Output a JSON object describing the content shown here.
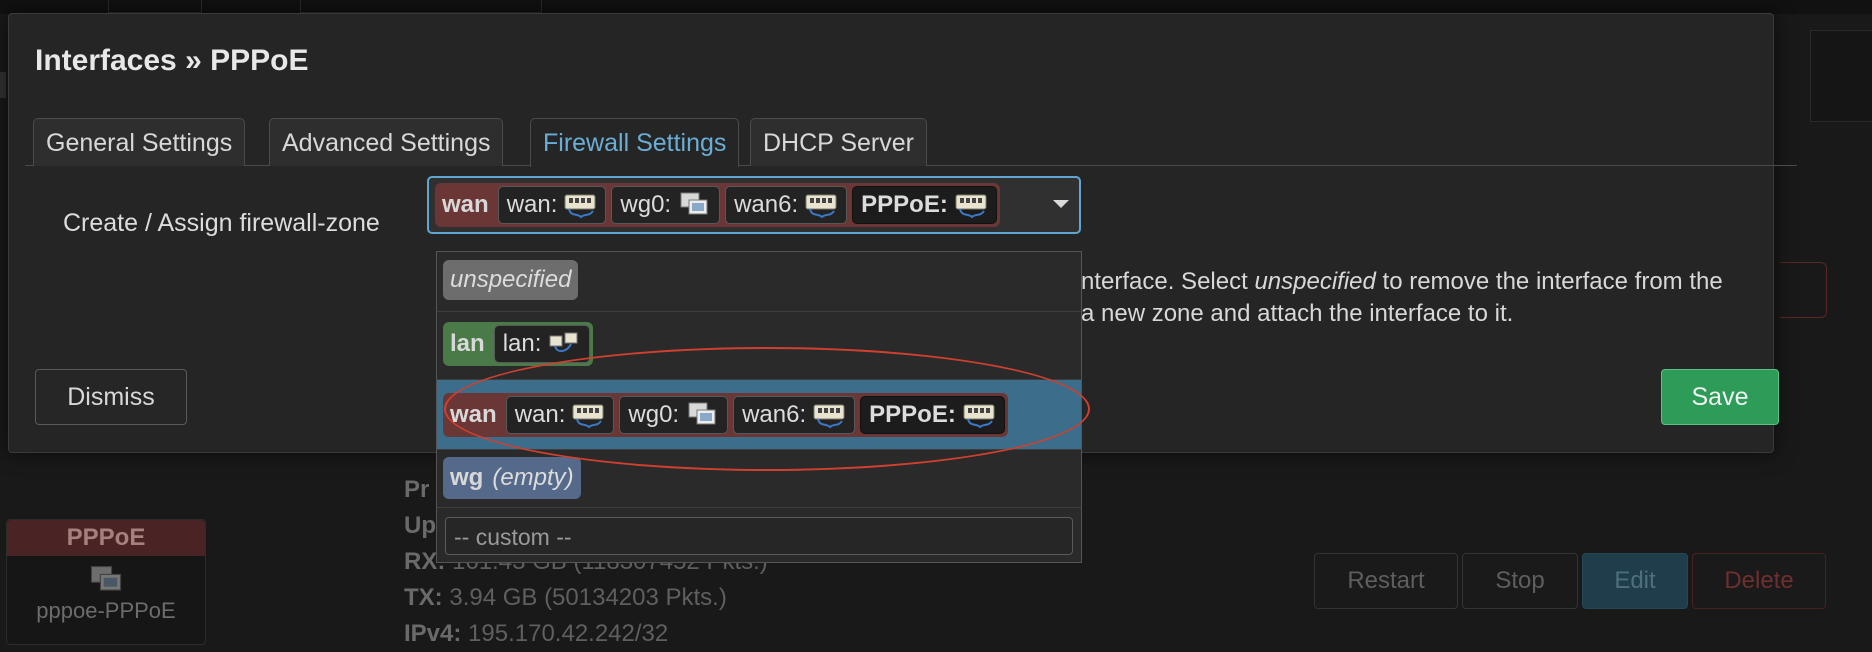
{
  "modal": {
    "title": "Interfaces » PPPoE",
    "tabs": [
      "General Settings",
      "Advanced Settings",
      "Firewall Settings",
      "DHCP Server"
    ],
    "active_tab": "Firewall Settings",
    "field_label": "Create / Assign firewall-zone",
    "help_line1_a": "nterface. Select ",
    "help_line1_em": "unspecified",
    "help_line1_b": " to remove the interface from the",
    "help_line2": "a new zone and attach the interface to it.",
    "dismiss_label": "Dismiss",
    "save_label": "Save"
  },
  "select": {
    "zone": "wan",
    "devices": [
      "wan:",
      "wg0:",
      "wan6:",
      "PPPoE:"
    ]
  },
  "dropdown": {
    "unspecified": "unspecified",
    "lan": {
      "zone": "lan",
      "devices": [
        "lan:"
      ]
    },
    "wan": {
      "zone": "wan",
      "devices": [
        "wan:",
        "wg0:",
        "wan6:",
        "PPPoE:"
      ]
    },
    "wg": {
      "zone": "wg",
      "note": "(empty)"
    },
    "custom_placeholder": "-- custom --"
  },
  "background": {
    "iface_name": "PPPoE",
    "iface_device": "pppoe-PPPoE",
    "stats": {
      "proto_label": "Pr",
      "uptime_label": "Up",
      "rx_label": "RX:",
      "rx_value": "161.43 GB (118307452 Pkts.)",
      "tx_label": "TX:",
      "tx_value": "3.94 GB (50134203 Pkts.)",
      "ipv4_label": "IPv4:",
      "ipv4_value": "195.170.42.242/32"
    },
    "buttons": [
      "Restart",
      "Stop",
      "Edit",
      "Delete"
    ]
  },
  "colors": {
    "zone_wan": "#6b3636",
    "zone_lan": "#4a7a48",
    "zone_wg": "#556a8a",
    "accent": "#5fa6d2",
    "save": "#2d9c58",
    "highlight_ellipse": "#d0402f"
  }
}
